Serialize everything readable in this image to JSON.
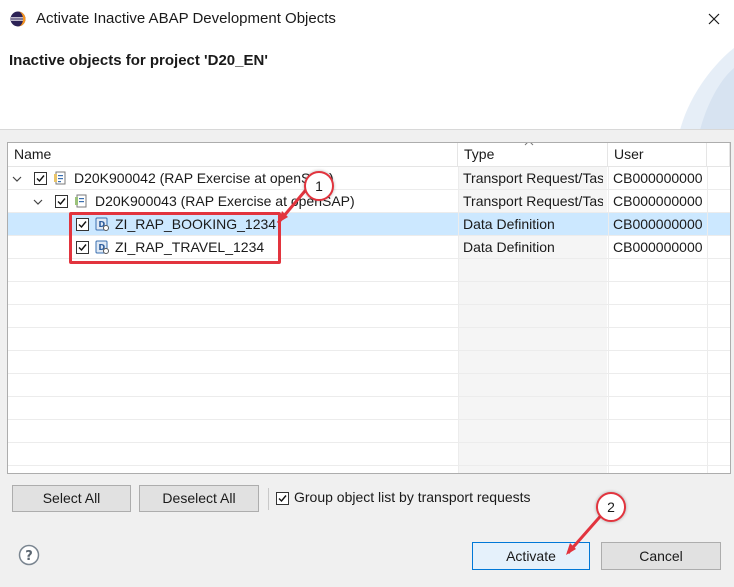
{
  "window": {
    "title": "Activate Inactive ABAP Development Objects",
    "icon": "eclipse-icon",
    "close_icon": "close-icon"
  },
  "header": {
    "title": "Inactive objects for project 'D20_EN'"
  },
  "table": {
    "columns": [
      "Name",
      "Type",
      "User"
    ],
    "rows": [
      {
        "name": "D20K900042 (RAP Exercise at openSAP)",
        "type": "Transport Request/Task",
        "user": "CB0000000000",
        "level": 0,
        "checked": true,
        "icon": "transport-request-icon"
      },
      {
        "name": "D20K900043 (RAP Exercise at openSAP)",
        "type": "Transport Request/Task",
        "user": "CB0000000000",
        "level": 1,
        "checked": true,
        "icon": "transport-task-icon"
      },
      {
        "name": "ZI_RAP_BOOKING_1234",
        "type": "Data Definition",
        "user": "CB0000000000",
        "level": 2,
        "checked": true,
        "icon": "data-definition-icon",
        "selected": true
      },
      {
        "name": "ZI_RAP_TRAVEL_1234",
        "type": "Data Definition",
        "user": "CB0000000000",
        "level": 2,
        "checked": true,
        "icon": "data-definition-icon"
      }
    ]
  },
  "buttons": {
    "select_all": "Select All",
    "deselect_all": "Deselect All",
    "group_checkbox_label": "Group object list by transport requests",
    "group_checked": true,
    "activate": "Activate",
    "cancel": "Cancel"
  },
  "annotations": {
    "callout_1": "1",
    "callout_2": "2",
    "color": "#e2343e"
  }
}
